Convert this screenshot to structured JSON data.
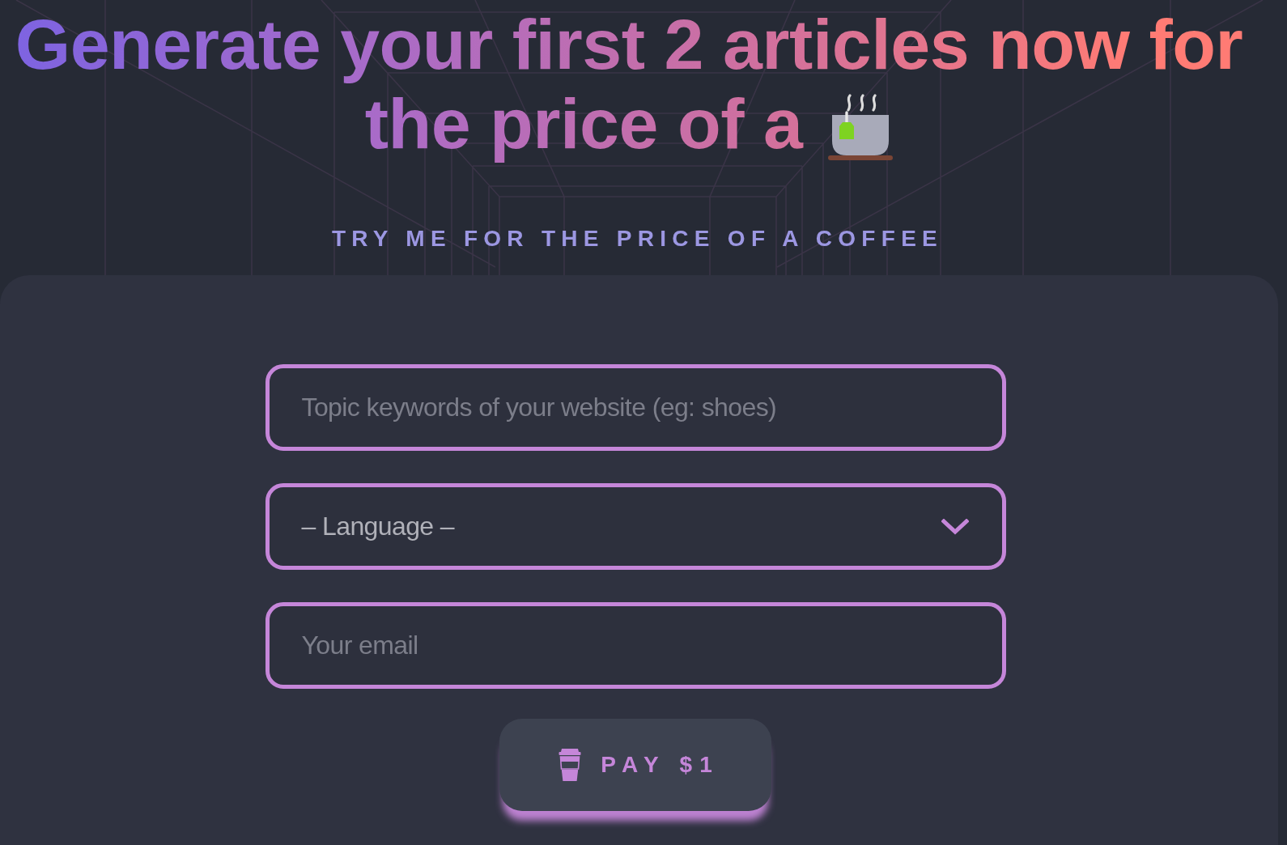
{
  "headline": {
    "lines": [
      "Generate your first 2 articles now for",
      "the price of a"
    ]
  },
  "tagline": "TRY ME FOR THE PRICE OF A COFFEE",
  "form": {
    "fields": [
      {
        "kind": "text",
        "placeholder": "Topic keywords of your website (eg: shoes)"
      },
      {
        "kind": "select",
        "value": "– Language –"
      },
      {
        "kind": "email",
        "placeholder": "Your email"
      }
    ],
    "submit": {
      "label": "PAY $1"
    }
  }
}
